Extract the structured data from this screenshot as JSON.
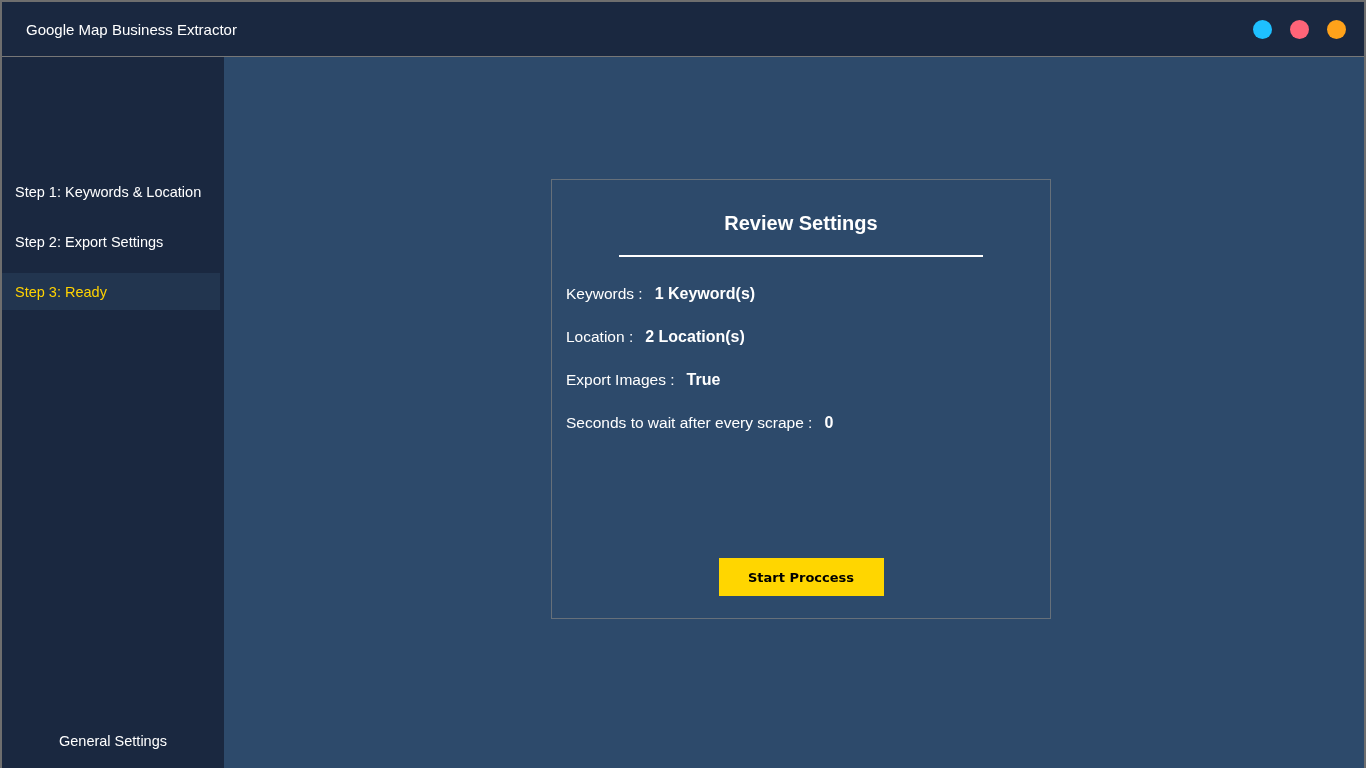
{
  "window": {
    "title": "Google Map Business Extractor"
  },
  "window_controls": [
    {
      "color": "#1ec0ff"
    },
    {
      "color": "#ff6478"
    },
    {
      "color": "#ffa21a"
    }
  ],
  "sidebar": {
    "items": [
      {
        "label": "Step 1: Keywords & Location",
        "selected": false
      },
      {
        "label": "Step 2: Export Settings",
        "selected": false
      },
      {
        "label": "Step 3: Ready",
        "selected": true
      }
    ],
    "footer": "General Settings"
  },
  "review": {
    "title": "Review Settings",
    "fields": [
      {
        "label": "Keywords :",
        "value": "1 Keyword(s)"
      },
      {
        "label": "Location :",
        "value": "2 Location(s)"
      },
      {
        "label": "Export Images :",
        "value": "True"
      },
      {
        "label": "Seconds to wait after every scrape :",
        "value": "0"
      }
    ],
    "button": "Start Proccess"
  }
}
